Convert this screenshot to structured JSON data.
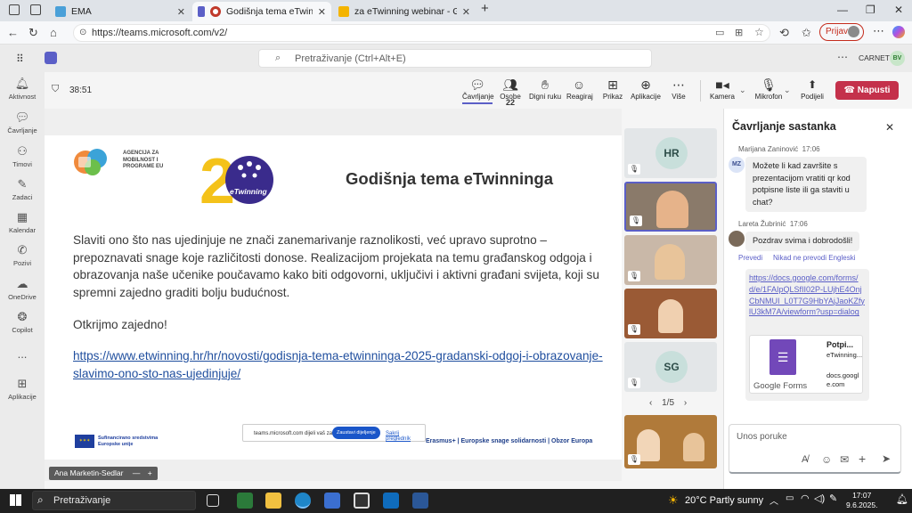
{
  "browser": {
    "tabs": [
      {
        "label": "EMA",
        "color": "#4aa0d8"
      },
      {
        "label": "Godišnja tema eTwinninga k",
        "color": "#c0392b"
      },
      {
        "label": "za eTwinning webinar - Google p",
        "color": "#f4b400"
      }
    ],
    "url": "https://teams.microsoft.com/v2/",
    "signin_label": "Prijava"
  },
  "teams": {
    "search_placeholder": "Pretraživanje (Ctrl+Alt+E)",
    "org": "CARNET",
    "user_initials": "BV",
    "rail": [
      {
        "label": "Aktivnost",
        "icon": "bell-icon"
      },
      {
        "label": "Čavrljanje",
        "icon": "chat-icon"
      },
      {
        "label": "Timovi",
        "icon": "teams-icon"
      },
      {
        "label": "Zadaci",
        "icon": "tasks-icon"
      },
      {
        "label": "Kalendar",
        "icon": "calendar-icon"
      },
      {
        "label": "Pozivi",
        "icon": "phone-icon"
      },
      {
        "label": "OneDrive",
        "icon": "cloud-icon"
      },
      {
        "label": "Copilot",
        "icon": "copilot-icon"
      },
      {
        "label": "...",
        "icon": "more-icon"
      },
      {
        "label": "Aplikacije",
        "icon": "plus-icon"
      }
    ],
    "meeting": {
      "timer": "38:51",
      "tools": [
        {
          "label": "Čavrljanje",
          "icon": "chat-icon"
        },
        {
          "label": "Osobe",
          "icon": "people-icon",
          "count": "22"
        },
        {
          "label": "Digni ruku",
          "icon": "hand-icon"
        },
        {
          "label": "Reagiraj",
          "icon": "smile-icon"
        },
        {
          "label": "Prikaz",
          "icon": "grid-icon"
        },
        {
          "label": "Aplikacije",
          "icon": "plus-icon"
        },
        {
          "label": "Više",
          "icon": "more-icon"
        },
        {
          "label": "Kamera",
          "icon": "camera-icon"
        },
        {
          "label": "Mikrofon",
          "icon": "mic-off-icon"
        },
        {
          "label": "Podijeli",
          "icon": "share-icon"
        }
      ],
      "leave_label": "Napusti",
      "presenter": "Ana Marketin-Sedlar"
    }
  },
  "slide": {
    "logo_text": "AGENCIJA ZA MOBILNOST I PROGRAME EU",
    "etwinning_text": "eTwinning",
    "title": "Godišnja tema eTwinninga",
    "body": "Slaviti ono što nas ujedinjuje ne znači zanemarivanje raznolikosti, već upravo suprotno – prepoznavati snage koje različitosti donose. Realizacijom projekata na temu građanskog odgoja i obrazovanja naše učenike poučavamo kako biti odgovorni, uključivi i aktivni građani svijeta, koji su spremni zajedno graditi bolju budućnost.",
    "cta": "Otkrijmo zajedno!",
    "link": "https://www.etwinning.hr/hr/novosti/godisnja-tema-etwinninga-2025-gradanski-odgoj-i-obrazovanje-slavimo-ono-sto-nas-ujedinjuje/",
    "eu_text": "Sufinancirano sredstvima Europske unije",
    "footer_programs": "Erasmus+  |  Europske snage solidarnosti  |  Obzor Europa",
    "share_notice": "teams.microsoft.com dijeli vaš zaslon.",
    "share_stop": "Zaustavi dijeljenje",
    "share_hide": "Sakrij pregledník"
  },
  "videos": {
    "tiles": [
      {
        "initials": "HR"
      },
      {
        "initials": ""
      },
      {
        "initials": ""
      },
      {
        "initials": ""
      },
      {
        "initials": "SG"
      }
    ],
    "pager": "1/5"
  },
  "chat": {
    "title": "Čavrljanje sastanka",
    "messages": [
      {
        "author": "Marijana Zaninović",
        "time": "17:06",
        "initials": "MZ",
        "text": "Možete li kad završite s prezentacijom vratiti qr kod potpisne liste ili ga staviti u chat?"
      },
      {
        "author": "Lareta Žubrinić",
        "time": "17:06",
        "text": "Pozdrav svima i dobrodošli!",
        "translate": "Prevedi",
        "no_translate": "Nikad ne prevodi Engleski"
      }
    ],
    "link_message": "https://docs.google.com/forms/d/e/1FAIpQLSfII02P-LUjhE4OnjCbNMUI_L0T7G9HbYAjJaoKZfylU3kM7A/viewform?usp=dialog",
    "card_title": "Potpi...",
    "card_desc": "eTwinning...",
    "card_domain": "docs.google.com",
    "card_brand": "Google Forms",
    "input_placeholder": "Unos poruke"
  },
  "taskbar": {
    "search": "Pretraživanje",
    "weather": "20°C  Partly sunny",
    "time": "17:07",
    "date": "9.6.2025."
  }
}
